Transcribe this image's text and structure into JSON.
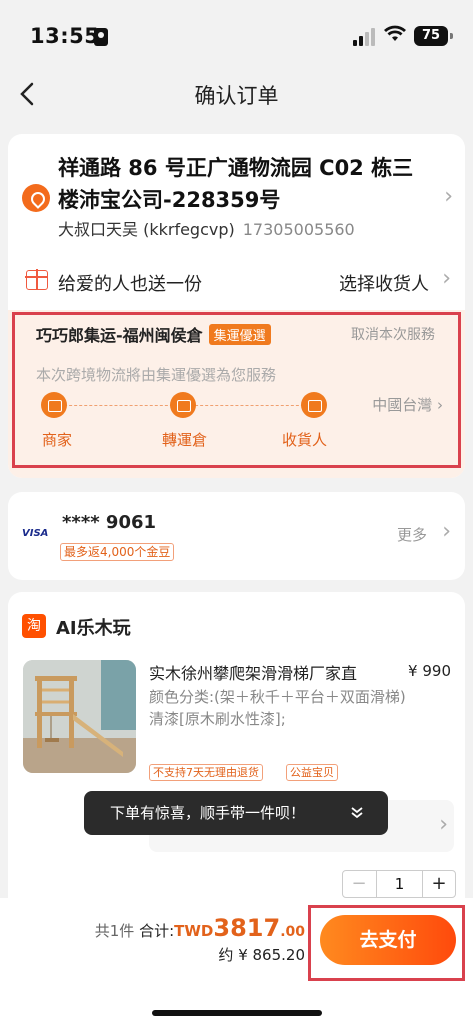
{
  "status_bar": {
    "time": "13:55",
    "battery": "75"
  },
  "nav": {
    "title": "确认订单"
  },
  "address": {
    "line": "祥通路 86 号正广通物流园 C02 栋三楼沛宝公司-228359号",
    "name": "大叔口天吴 (kkrfegcvp)",
    "phone": "17305005560"
  },
  "gift": {
    "label": "给爱的人也送一份",
    "action": "选择收货人"
  },
  "shipping": {
    "title": "巧巧郎集运-福州闽侯倉",
    "tag": "集運優選",
    "cancel": "取消本次服務",
    "description": "本次跨境物流將由集運優選為您服務",
    "steps": [
      "商家",
      "轉運倉",
      "收貨人"
    ],
    "region": "中國台灣"
  },
  "payment": {
    "card_brand": "VISA",
    "card_number": "**** 9061",
    "coin_badge": "最多返4,000个金豆",
    "more": "更多"
  },
  "store": {
    "icon_text": "淘",
    "name": "AI乐木玩"
  },
  "product": {
    "title": "实木徐州攀爬架滑滑梯厂家直",
    "price": "¥ 990",
    "variant": "颜色分类:(架＋秋千＋平台＋双面滑梯) 清漆[原木刷水性漆];",
    "tags": [
      "不支持7天无理由退货",
      "公益宝贝"
    ],
    "quantity": "1",
    "minus": "−",
    "plus": "+"
  },
  "toast": {
    "text": "下单有惊喜，顺手带一件呗！"
  },
  "checkout": {
    "count": "共1件",
    "total_label": "合计:",
    "currency": "TWD",
    "amount": "3817",
    "cents": ".00",
    "approx": "约 ¥ 865.20",
    "pay_label": "去支付"
  },
  "colors": {
    "accent": "#f07a1e",
    "price_orange": "#e2621b",
    "highlight": "#d9414d"
  }
}
